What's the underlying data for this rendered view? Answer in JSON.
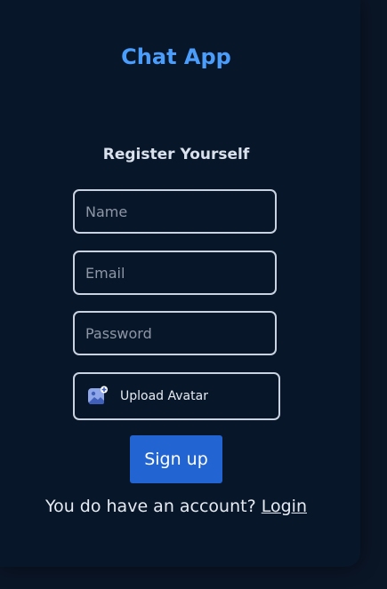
{
  "app": {
    "title": "Chat App"
  },
  "form": {
    "heading": "Register Yourself",
    "name_placeholder": "Name",
    "email_placeholder": "Email",
    "password_placeholder": "Password",
    "upload_label": "Upload Avatar",
    "upload_icon": "image-add-icon",
    "submit_label": "Sign up"
  },
  "footer": {
    "prompt": "You do have an account?",
    "login_label": "Login"
  },
  "colors": {
    "background": "#0a1526",
    "accent": "#4b9dfb",
    "button": "#2364d3"
  }
}
